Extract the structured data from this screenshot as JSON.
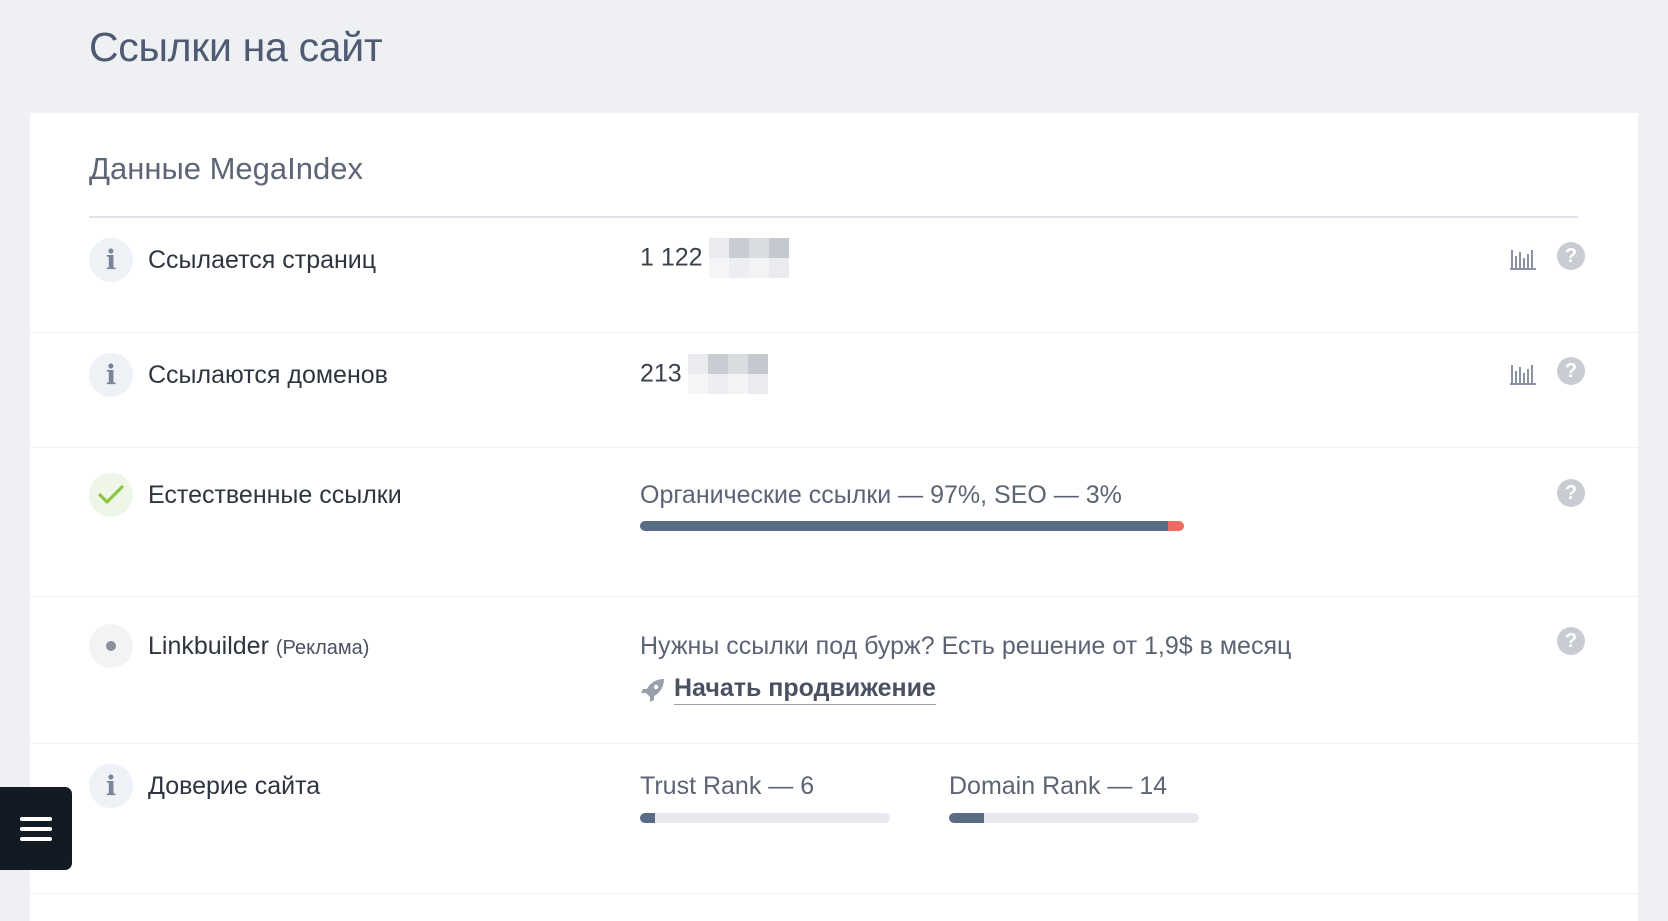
{
  "page": {
    "title": "Ссылки на сайт"
  },
  "card": {
    "title": "Данные MegaIndex"
  },
  "rows": {
    "pages": {
      "label": "Ссылается страниц",
      "value": "1 122"
    },
    "domains": {
      "label": "Ссылаются доменов",
      "value": "213"
    },
    "natural": {
      "label": "Естественные ссылки",
      "value": "Органические ссылки — 97%, SEO — 3%",
      "organic_percent": 97,
      "seo_percent": 3
    },
    "linkbuilder": {
      "label": "Linkbuilder",
      "label_note": "(Реклама)",
      "text": "Нужны ссылки под бурж? Есть решение от 1,9$ в месяц",
      "link_label": "Начать продвижение"
    },
    "trust": {
      "label": "Доверие сайта",
      "trust_rank_label": "Trust Rank — 6",
      "trust_rank_value": 6,
      "domain_rank_label": "Domain Rank — 14",
      "domain_rank_value": 14
    }
  },
  "icons": {
    "info": "info-icon",
    "check": "check-icon",
    "dot": "dot-icon",
    "help": "help-icon",
    "chart": "chart-icon",
    "rocket": "rocket-icon",
    "menu": "menu-icon"
  },
  "colors": {
    "bar": "#5a6b84",
    "seo": "#ee6a62",
    "check": "#8cc63f",
    "menu_bg": "#121a24"
  }
}
